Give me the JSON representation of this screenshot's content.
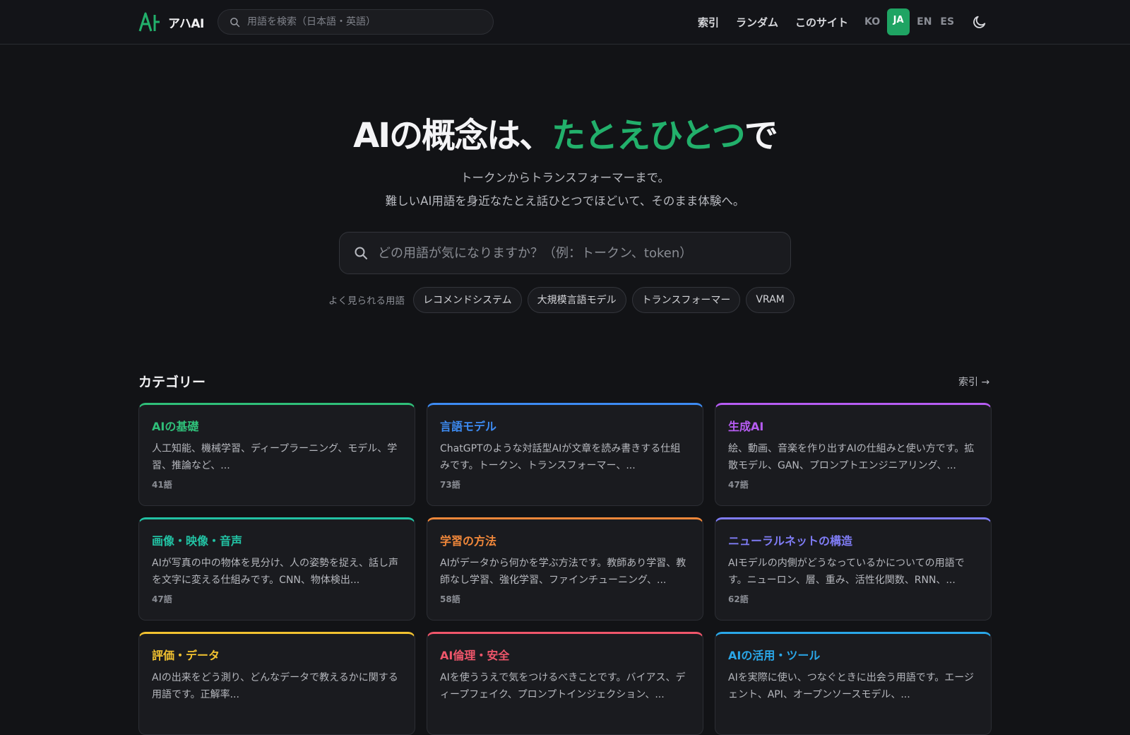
{
  "header": {
    "logo_text": "アハAI",
    "search_placeholder": "用語を検索（日本語・英語）",
    "nav": [
      "索引",
      "ランダム",
      "このサイト"
    ],
    "languages": [
      "KO",
      "JA",
      "EN",
      "ES"
    ],
    "active_language": "JA",
    "brand_color": "#22b06b"
  },
  "hero": {
    "title_prefix": "AIの概念は、",
    "title_accent": "たとえひとつ",
    "title_suffix": "で",
    "subtitle_line1": "トークンからトランスフォーマーまで。",
    "subtitle_line2": "難しいAI用語を身近なたとえ話ひとつでほどいて、そのまま体験へ。",
    "search_placeholder": "どの用語が気になりますか？（例：トークン、token）",
    "popular_label": "よく見られる用語",
    "popular_terms": [
      "レコメンドシステム",
      "大規模言語モデル",
      "トランスフォーマー",
      "VRAM"
    ]
  },
  "categories": {
    "title": "カテゴリー",
    "index_link": "索引 →",
    "items": [
      {
        "name": "AIの基礎",
        "desc": "人工知能、機械学習、ディープラーニング、モデル、学習、推論など、...",
        "count": "41語",
        "color": "#2fbf79"
      },
      {
        "name": "言語モデル",
        "desc": "ChatGPTのような対話型AIが文章を読み書きする仕組みです。トークン、トランスフォーマー、...",
        "count": "73語",
        "color": "#3d8bf2"
      },
      {
        "name": "生成AI",
        "desc": "絵、動画、音楽を作り出すAIの仕組みと使い方です。拡散モデル、GAN、プロンプトエンジニアリング、...",
        "count": "47語",
        "color": "#b65cf2"
      },
      {
        "name": "画像・映像・音声",
        "desc": "AIが写真の中の物体を見分け、人の姿勢を捉え、話し声を文字に変える仕組みです。CNN、物体検出...",
        "count": "47語",
        "color": "#22c1a3"
      },
      {
        "name": "学習の方法",
        "desc": "AIがデータから何かを学ぶ方法です。教師あり学習、教師なし学習、強化学習、ファインチューニング、...",
        "count": "58語",
        "color": "#f0873a"
      },
      {
        "name": "ニューラルネットの構造",
        "desc": "AIモデルの内側がどうなっているかについての用語です。ニューロン、層、重み、活性化関数、RNN、...",
        "count": "62語",
        "color": "#7f7cf5"
      },
      {
        "name": "評価・データ",
        "desc": "AIの出来をどう測り、どんなデータで教えるかに関する用語です。正解率...",
        "count": "",
        "color": "#f2c230"
      },
      {
        "name": "AI倫理・安全",
        "desc": "AIを使ううえで気をつけるべきことです。バイアス、ディープフェイク、プロンプトインジェクション、...",
        "count": "",
        "color": "#f0566b"
      },
      {
        "name": "AIの活用・ツール",
        "desc": "AIを実際に使い、つなぐときに出会う用語です。エージェント、API、オープンソースモデル、...",
        "count": "",
        "color": "#2aa7e8"
      }
    ]
  }
}
